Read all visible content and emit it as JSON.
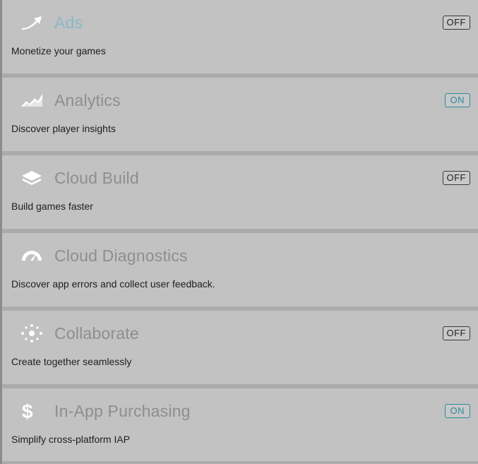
{
  "services": [
    {
      "key": "ads",
      "icon": "ads-arrow-icon",
      "title": "Ads",
      "description": "Monetize your games",
      "toggle": "OFF"
    },
    {
      "key": "analytics",
      "icon": "analytics-chart-icon",
      "title": "Analytics",
      "description": "Discover player insights",
      "toggle": "ON"
    },
    {
      "key": "cloud-build",
      "icon": "cloud-build-layers-icon",
      "title": "Cloud Build",
      "description": "Build games faster",
      "toggle": "OFF"
    },
    {
      "key": "cloud-diagnostics",
      "icon": "cloud-diagnostics-gauge-icon",
      "title": "Cloud Diagnostics",
      "description": "Discover app errors and collect user feedback.",
      "toggle": ""
    },
    {
      "key": "collaborate",
      "icon": "collaborate-network-icon",
      "title": "Collaborate",
      "description": "Create together seamlessly",
      "toggle": "OFF"
    },
    {
      "key": "iap",
      "icon": "dollar-icon",
      "title": "In-App Purchasing",
      "description": "Simplify cross-platform IAP",
      "toggle": "ON"
    }
  ],
  "colors": {
    "panel_bg": "#c2c2c2",
    "separator": "#ababab",
    "title_gray": "#8e8e8e",
    "title_highlight": "#8cb6c8",
    "on_accent": "#2b8a9b"
  }
}
